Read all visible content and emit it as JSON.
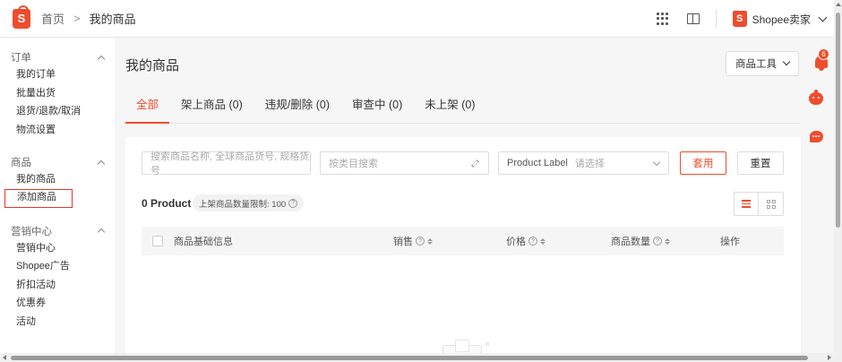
{
  "header": {
    "logo_letter": "S",
    "breadcrumb_home": "首页",
    "breadcrumb_sep": ">",
    "breadcrumb_current": "我的商品",
    "seller_logo_letter": "S",
    "seller_name": "Shopee卖家",
    "icons": [
      "apps-grid-icon",
      "book-icon",
      "chevron-down-icon"
    ]
  },
  "sidebar": {
    "sections": [
      {
        "title": "订单",
        "items": [
          "我的订单",
          "批量出货",
          "退货/退款/取消",
          "物流设置"
        ]
      },
      {
        "title": "商品",
        "items": [
          "我的商品",
          "添加商品"
        ]
      },
      {
        "title": "营销中心",
        "items": [
          "营销中心",
          "Shopee广告",
          "折扣活动",
          "优惠券",
          "活动"
        ]
      }
    ],
    "highlighted_item": "添加商品"
  },
  "main": {
    "title": "我的商品",
    "tools_button": "商品工具",
    "tabs": [
      "全部",
      "架上商品 (0)",
      "违规/删除 (0)",
      "审查中 (0)",
      "未上架 (0)"
    ],
    "active_tab": "全部",
    "filters": {
      "search_placeholder": "搜索商品名称, 全球商品货号, 规格货号",
      "category_placeholder": "按类目搜索",
      "label_title": "Product Label",
      "label_placeholder": "请选择",
      "apply": "套用",
      "reset": "重置"
    },
    "count_text": "0 Product",
    "limit_text": "上架商品数量限制: 100",
    "help_mark": "?",
    "table_headers": [
      "商品基础信息",
      "销售",
      "价格",
      "商品数量",
      "操作"
    ]
  },
  "right_panel": {
    "notification_count": "6"
  },
  "colors": {
    "brand": "#ee4d2d",
    "highlight_border": "#e0382a"
  }
}
